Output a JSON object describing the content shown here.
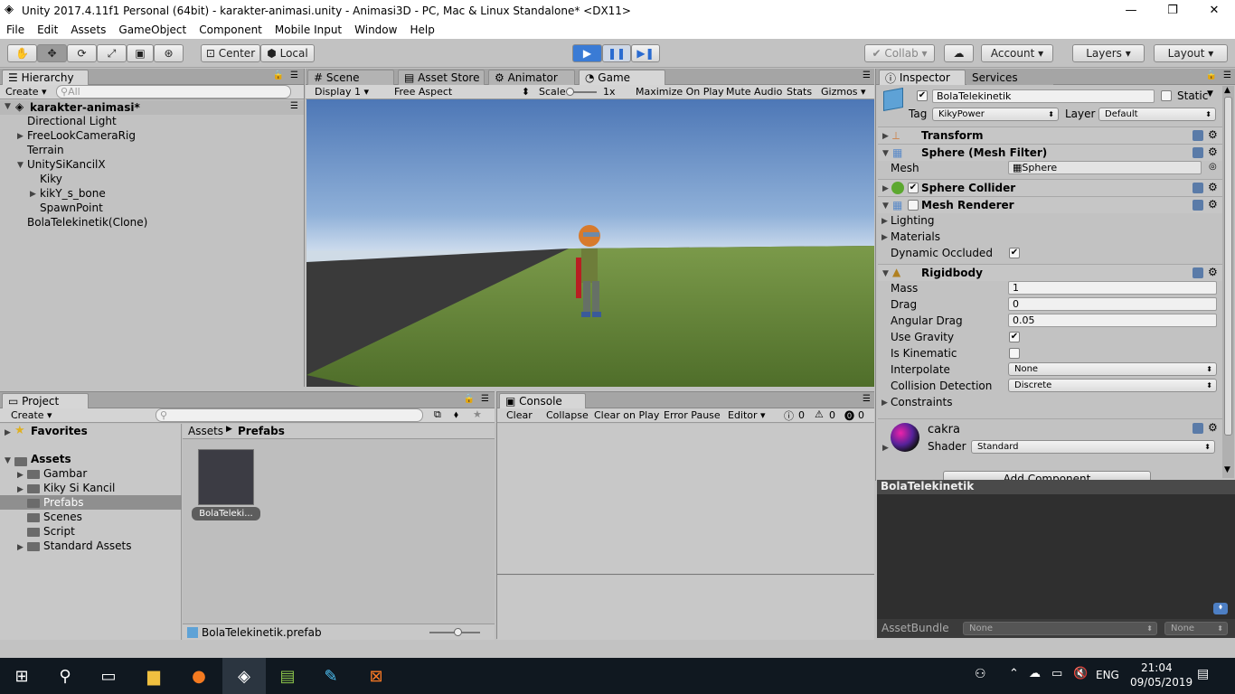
{
  "window": {
    "title": "Unity 2017.4.11f1 Personal (64bit) - karakter-animasi.unity - Animasi3D - PC, Mac & Linux Standalone* <DX11>"
  },
  "menu": [
    "File",
    "Edit",
    "Assets",
    "GameObject",
    "Component",
    "Mobile Input",
    "Window",
    "Help"
  ],
  "toolbar": {
    "center": "Center",
    "local": "Local",
    "collab": "Collab ▾",
    "account": "Account",
    "layers": "Layers",
    "layout": "Layout"
  },
  "hierarchy": {
    "tab": "Hierarchy",
    "create": "Create",
    "search_placeholder": "All",
    "scene": "karakter-animasi*",
    "items": [
      "Directional Light",
      "FreeLookCameraRig",
      "Terrain",
      "UnitySiKancilX",
      "Kiky",
      "kikY_s_bone",
      "SpawnPoint",
      "BolaTelekinetik(Clone)"
    ]
  },
  "view_tabs": {
    "scene": "Scene",
    "asset_store": "Asset Store",
    "animator": "Animator",
    "game": "Game"
  },
  "game_bar": {
    "display": "Display 1",
    "aspect": "Free Aspect",
    "scale_label": "Scale",
    "scale_value": "1x",
    "maximize": "Maximize On Play",
    "mute": "Mute Audio",
    "stats": "Stats",
    "gizmos": "Gizmos"
  },
  "inspector": {
    "tab": "Inspector",
    "services": "Services",
    "object_name": "BolaTelekinetik",
    "static": "Static",
    "tag_label": "Tag",
    "tag": "KikyPower",
    "layer_label": "Layer",
    "layer": "Default",
    "components": [
      "Transform",
      "Sphere (Mesh Filter)",
      "Sphere Collider",
      "Mesh Renderer",
      "Rigidbody"
    ],
    "mesh_label": "Mesh",
    "mesh": "Sphere",
    "lighting": "Lighting",
    "materials": "Materials",
    "dynamic_occluded": "Dynamic Occluded",
    "rigidbody": {
      "mass_label": "Mass",
      "mass": "1",
      "drag_label": "Drag",
      "drag": "0",
      "angular_label": "Angular Drag",
      "angular": "0.05",
      "gravity_label": "Use Gravity",
      "kinematic_label": "Is Kinematic",
      "interpolate_label": "Interpolate",
      "interpolate": "None",
      "collision_label": "Collision Detection",
      "collision": "Discrete",
      "constraints": "Constraints"
    },
    "material": "cakra",
    "shader_label": "Shader",
    "shader": "Standard",
    "add_component": "Add Component",
    "preview_title": "BolaTelekinetik",
    "assetbundle_label": "AssetBundle",
    "assetbundle": "None",
    "assetbundle_variant": "None"
  },
  "project": {
    "tab": "Project",
    "create": "Create",
    "favorites": "Favorites",
    "assets": "Assets",
    "folders": [
      "Gambar",
      "Kiky Si Kancil",
      "Prefabs",
      "Scenes",
      "Script",
      "Standard Assets"
    ],
    "breadcrumb_root": "Assets",
    "breadcrumb_current": "Prefabs",
    "asset_label": "BolaTeleki...",
    "selected_file": "BolaTelekinetik.prefab"
  },
  "console": {
    "tab": "Console",
    "clear": "Clear",
    "collapse": "Collapse",
    "clear_on_play": "Clear on Play",
    "error_pause": "Error Pause",
    "editor": "Editor",
    "info_count": "0",
    "warn_count": "0",
    "error_count": "0"
  },
  "taskbar": {
    "lang": "ENG",
    "time": "21:04",
    "date": "09/05/2019"
  }
}
